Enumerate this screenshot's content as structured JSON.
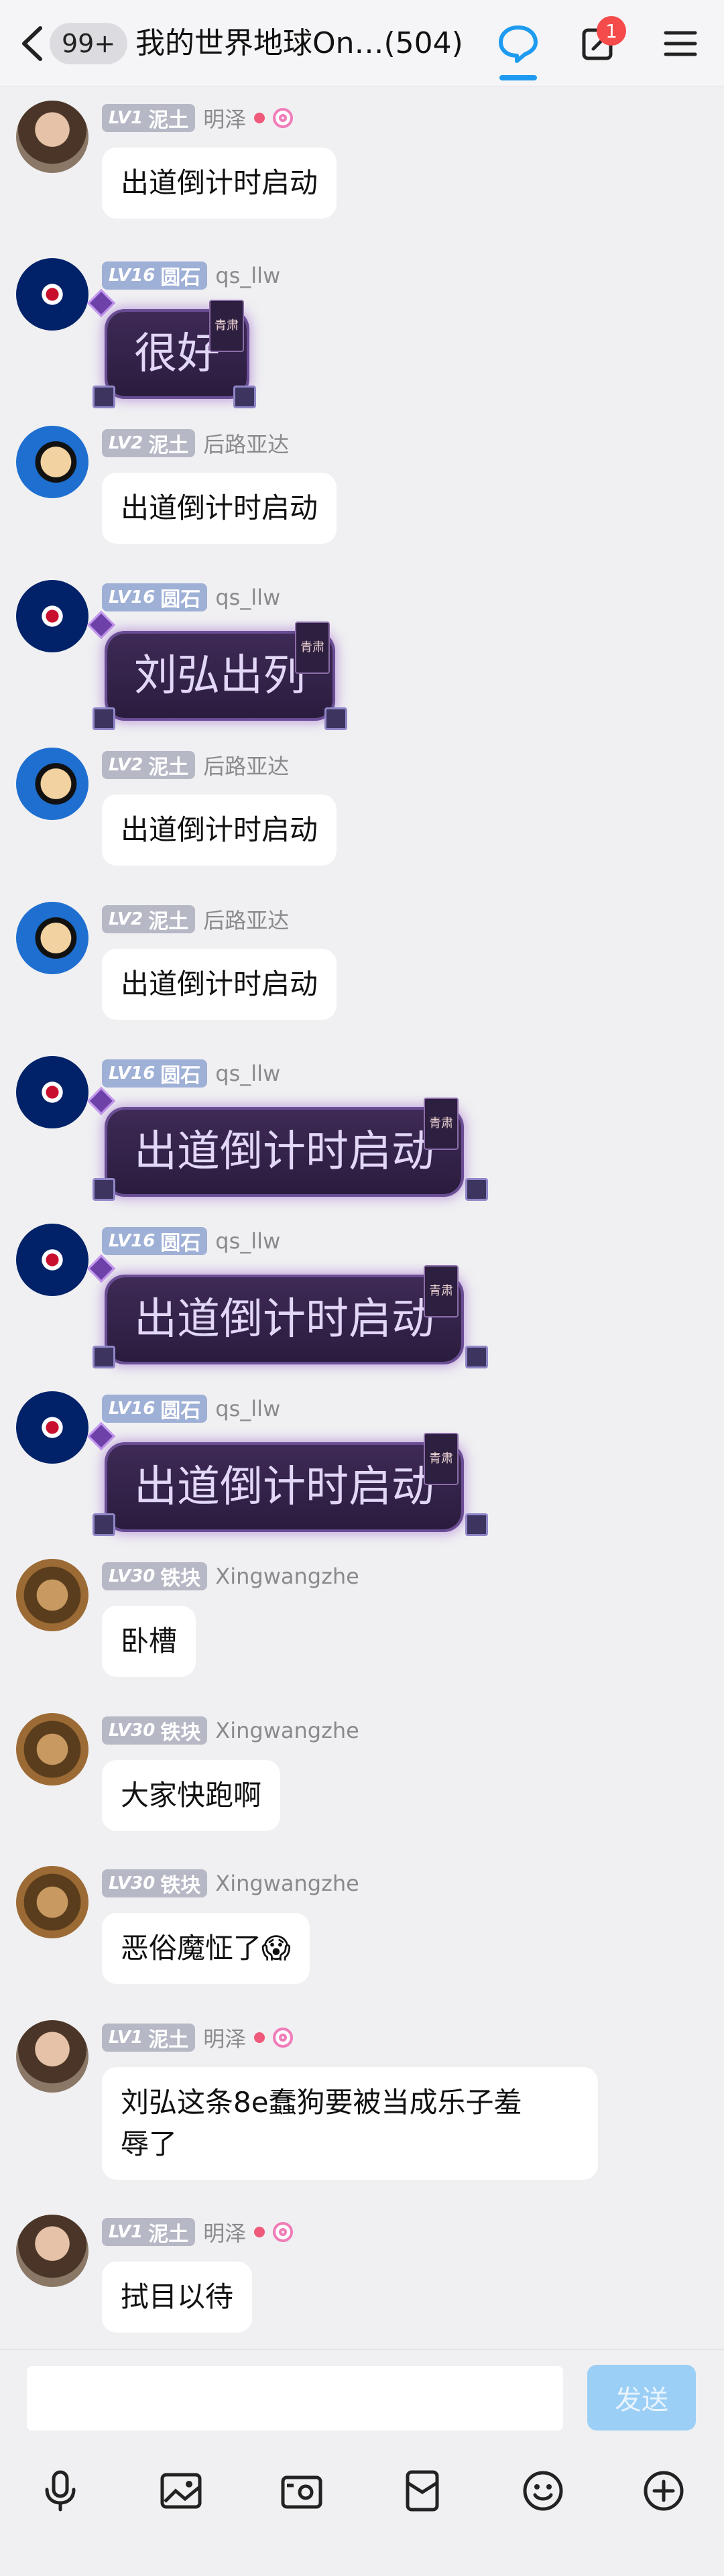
{
  "header": {
    "unread_badge": "99+",
    "title": "我的世界地球On…(504)",
    "edit_badge_count": "1",
    "accent": "#1e9bf0"
  },
  "messages": [
    {
      "level": "LV1",
      "rank": "泥土",
      "name": "明泽",
      "text": "出道倒计时启动",
      "style": "normal"
    },
    {
      "level": "LV16",
      "rank": "圆石",
      "name": "qs_llw",
      "text": "很好",
      "style": "special",
      "tag": "青肃"
    },
    {
      "level": "LV2",
      "rank": "泥土",
      "name": "后路亚达",
      "text": "出道倒计时启动",
      "style": "normal"
    },
    {
      "level": "LV16",
      "rank": "圆石",
      "name": "qs_llw",
      "text": "刘弘出列",
      "style": "special",
      "tag": "青肃"
    },
    {
      "level": "LV2",
      "rank": "泥土",
      "name": "后路亚达",
      "text": "出道倒计时启动",
      "style": "normal"
    },
    {
      "level": "LV2",
      "rank": "泥土",
      "name": "后路亚达",
      "text": "出道倒计时启动",
      "style": "normal"
    },
    {
      "level": "LV16",
      "rank": "圆石",
      "name": "qs_llw",
      "text": "出道倒计时启动",
      "style": "special",
      "tag": "青肃"
    },
    {
      "level": "LV16",
      "rank": "圆石",
      "name": "qs_llw",
      "text": "出道倒计时启动",
      "style": "special",
      "tag": "青肃"
    },
    {
      "level": "LV16",
      "rank": "圆石",
      "name": "qs_llw",
      "text": "出道倒计时启动",
      "style": "special",
      "tag": "青肃"
    },
    {
      "level": "LV30",
      "rank": "铁块",
      "name": "Xingwangzhe",
      "text": "卧槽",
      "style": "normal"
    },
    {
      "level": "LV30",
      "rank": "铁块",
      "name": "Xingwangzhe",
      "text": "大家快跑啊",
      "style": "normal"
    },
    {
      "level": "LV30",
      "rank": "铁块",
      "name": "Xingwangzhe",
      "text": "恶俗魔怔了😱",
      "style": "normal"
    },
    {
      "level": "LV1",
      "rank": "泥土",
      "name": "明泽",
      "text_line1": "刘弘这条8e蠢狗要被当成乐子羞",
      "text_line2": "辱了",
      "style": "normal"
    },
    {
      "level": "LV1",
      "rank": "泥土",
      "name": "明泽",
      "text": "拭目以待",
      "style": "normal"
    }
  ],
  "input": {
    "value": "",
    "send_label": "发送"
  },
  "toolbar": [
    {
      "icon": "microphone-icon"
    },
    {
      "icon": "image-icon"
    },
    {
      "icon": "camera-icon"
    },
    {
      "icon": "red-packet-icon"
    },
    {
      "icon": "emoji-icon"
    },
    {
      "icon": "plus-icon"
    }
  ]
}
